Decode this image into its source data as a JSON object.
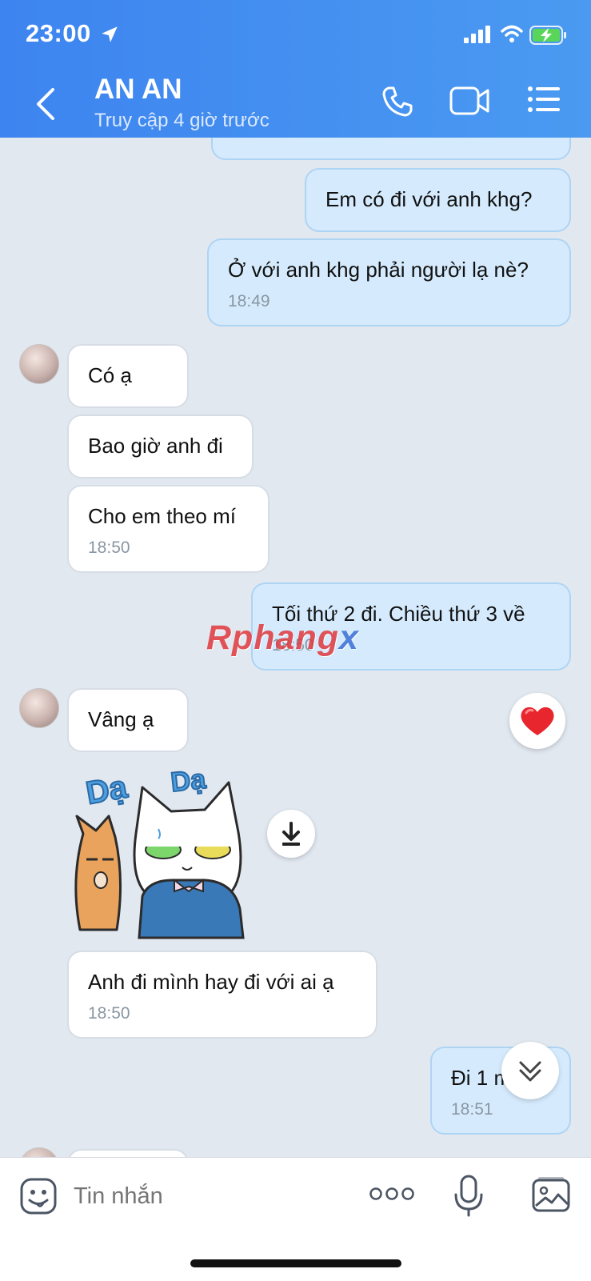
{
  "status_bar": {
    "time": "23:00"
  },
  "header": {
    "contact_name": "AN AN",
    "contact_status": "Truy cập 4 giờ trước"
  },
  "messages": [
    {
      "text": "Em có đi với anh khg?",
      "time": ""
    },
    {
      "text": "Ở với anh khg phải người lạ nè?",
      "time": "18:49"
    },
    {
      "text": "Có ạ",
      "time": ""
    },
    {
      "text": "Bao giờ anh đi",
      "time": ""
    },
    {
      "text": "Cho em theo mí",
      "time": "18:50"
    },
    {
      "text": "Tối thứ 2 đi. Chiều thứ 3 về",
      "time": "18:50"
    },
    {
      "text": "Vâng ạ",
      "time": ""
    },
    {
      "text": "Anh đi mình hay đi với ai ạ",
      "time": "18:50"
    },
    {
      "text": "Đi 1 mình",
      "time": "18:51"
    }
  ],
  "sticker": {
    "text_1": "Dạ",
    "text_2": "Dạ"
  },
  "watermark": {
    "text_main": "Rphang",
    "text_end": "x"
  },
  "input": {
    "placeholder": "Tin nhắn"
  },
  "colors": {
    "header": "#3d84f0",
    "outgoing": "#d5ebfd",
    "incoming": "#ffffff",
    "chat_bg": "#e2e8f0"
  }
}
